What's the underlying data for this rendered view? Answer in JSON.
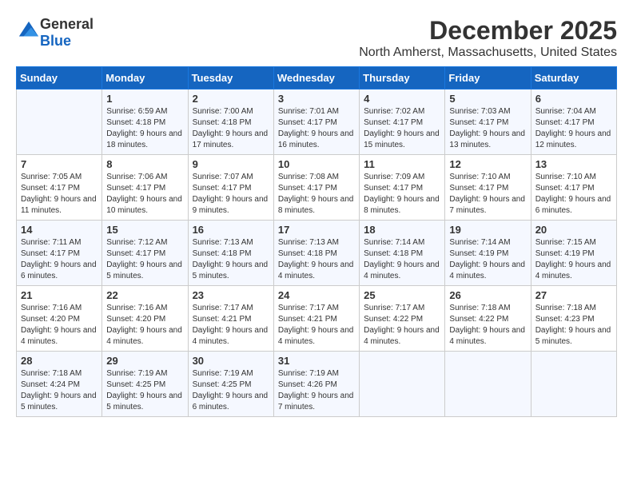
{
  "header": {
    "logo": {
      "general": "General",
      "blue": "Blue"
    },
    "title": "December 2025",
    "location": "North Amherst, Massachusetts, United States"
  },
  "weekdays": [
    "Sunday",
    "Monday",
    "Tuesday",
    "Wednesday",
    "Thursday",
    "Friday",
    "Saturday"
  ],
  "weeks": [
    [
      {
        "day": "",
        "sunrise": "",
        "sunset": "",
        "daylight": ""
      },
      {
        "day": "1",
        "sunrise": "Sunrise: 6:59 AM",
        "sunset": "Sunset: 4:18 PM",
        "daylight": "Daylight: 9 hours and 18 minutes."
      },
      {
        "day": "2",
        "sunrise": "Sunrise: 7:00 AM",
        "sunset": "Sunset: 4:18 PM",
        "daylight": "Daylight: 9 hours and 17 minutes."
      },
      {
        "day": "3",
        "sunrise": "Sunrise: 7:01 AM",
        "sunset": "Sunset: 4:17 PM",
        "daylight": "Daylight: 9 hours and 16 minutes."
      },
      {
        "day": "4",
        "sunrise": "Sunrise: 7:02 AM",
        "sunset": "Sunset: 4:17 PM",
        "daylight": "Daylight: 9 hours and 15 minutes."
      },
      {
        "day": "5",
        "sunrise": "Sunrise: 7:03 AM",
        "sunset": "Sunset: 4:17 PM",
        "daylight": "Daylight: 9 hours and 13 minutes."
      },
      {
        "day": "6",
        "sunrise": "Sunrise: 7:04 AM",
        "sunset": "Sunset: 4:17 PM",
        "daylight": "Daylight: 9 hours and 12 minutes."
      }
    ],
    [
      {
        "day": "7",
        "sunrise": "Sunrise: 7:05 AM",
        "sunset": "Sunset: 4:17 PM",
        "daylight": "Daylight: 9 hours and 11 minutes."
      },
      {
        "day": "8",
        "sunrise": "Sunrise: 7:06 AM",
        "sunset": "Sunset: 4:17 PM",
        "daylight": "Daylight: 9 hours and 10 minutes."
      },
      {
        "day": "9",
        "sunrise": "Sunrise: 7:07 AM",
        "sunset": "Sunset: 4:17 PM",
        "daylight": "Daylight: 9 hours and 9 minutes."
      },
      {
        "day": "10",
        "sunrise": "Sunrise: 7:08 AM",
        "sunset": "Sunset: 4:17 PM",
        "daylight": "Daylight: 9 hours and 8 minutes."
      },
      {
        "day": "11",
        "sunrise": "Sunrise: 7:09 AM",
        "sunset": "Sunset: 4:17 PM",
        "daylight": "Daylight: 9 hours and 8 minutes."
      },
      {
        "day": "12",
        "sunrise": "Sunrise: 7:10 AM",
        "sunset": "Sunset: 4:17 PM",
        "daylight": "Daylight: 9 hours and 7 minutes."
      },
      {
        "day": "13",
        "sunrise": "Sunrise: 7:10 AM",
        "sunset": "Sunset: 4:17 PM",
        "daylight": "Daylight: 9 hours and 6 minutes."
      }
    ],
    [
      {
        "day": "14",
        "sunrise": "Sunrise: 7:11 AM",
        "sunset": "Sunset: 4:17 PM",
        "daylight": "Daylight: 9 hours and 6 minutes."
      },
      {
        "day": "15",
        "sunrise": "Sunrise: 7:12 AM",
        "sunset": "Sunset: 4:17 PM",
        "daylight": "Daylight: 9 hours and 5 minutes."
      },
      {
        "day": "16",
        "sunrise": "Sunrise: 7:13 AM",
        "sunset": "Sunset: 4:18 PM",
        "daylight": "Daylight: 9 hours and 5 minutes."
      },
      {
        "day": "17",
        "sunrise": "Sunrise: 7:13 AM",
        "sunset": "Sunset: 4:18 PM",
        "daylight": "Daylight: 9 hours and 4 minutes."
      },
      {
        "day": "18",
        "sunrise": "Sunrise: 7:14 AM",
        "sunset": "Sunset: 4:18 PM",
        "daylight": "Daylight: 9 hours and 4 minutes."
      },
      {
        "day": "19",
        "sunrise": "Sunrise: 7:14 AM",
        "sunset": "Sunset: 4:19 PM",
        "daylight": "Daylight: 9 hours and 4 minutes."
      },
      {
        "day": "20",
        "sunrise": "Sunrise: 7:15 AM",
        "sunset": "Sunset: 4:19 PM",
        "daylight": "Daylight: 9 hours and 4 minutes."
      }
    ],
    [
      {
        "day": "21",
        "sunrise": "Sunrise: 7:16 AM",
        "sunset": "Sunset: 4:20 PM",
        "daylight": "Daylight: 9 hours and 4 minutes."
      },
      {
        "day": "22",
        "sunrise": "Sunrise: 7:16 AM",
        "sunset": "Sunset: 4:20 PM",
        "daylight": "Daylight: 9 hours and 4 minutes."
      },
      {
        "day": "23",
        "sunrise": "Sunrise: 7:17 AM",
        "sunset": "Sunset: 4:21 PM",
        "daylight": "Daylight: 9 hours and 4 minutes."
      },
      {
        "day": "24",
        "sunrise": "Sunrise: 7:17 AM",
        "sunset": "Sunset: 4:21 PM",
        "daylight": "Daylight: 9 hours and 4 minutes."
      },
      {
        "day": "25",
        "sunrise": "Sunrise: 7:17 AM",
        "sunset": "Sunset: 4:22 PM",
        "daylight": "Daylight: 9 hours and 4 minutes."
      },
      {
        "day": "26",
        "sunrise": "Sunrise: 7:18 AM",
        "sunset": "Sunset: 4:22 PM",
        "daylight": "Daylight: 9 hours and 4 minutes."
      },
      {
        "day": "27",
        "sunrise": "Sunrise: 7:18 AM",
        "sunset": "Sunset: 4:23 PM",
        "daylight": "Daylight: 9 hours and 5 minutes."
      }
    ],
    [
      {
        "day": "28",
        "sunrise": "Sunrise: 7:18 AM",
        "sunset": "Sunset: 4:24 PM",
        "daylight": "Daylight: 9 hours and 5 minutes."
      },
      {
        "day": "29",
        "sunrise": "Sunrise: 7:19 AM",
        "sunset": "Sunset: 4:25 PM",
        "daylight": "Daylight: 9 hours and 5 minutes."
      },
      {
        "day": "30",
        "sunrise": "Sunrise: 7:19 AM",
        "sunset": "Sunset: 4:25 PM",
        "daylight": "Daylight: 9 hours and 6 minutes."
      },
      {
        "day": "31",
        "sunrise": "Sunrise: 7:19 AM",
        "sunset": "Sunset: 4:26 PM",
        "daylight": "Daylight: 9 hours and 7 minutes."
      },
      {
        "day": "",
        "sunrise": "",
        "sunset": "",
        "daylight": ""
      },
      {
        "day": "",
        "sunrise": "",
        "sunset": "",
        "daylight": ""
      },
      {
        "day": "",
        "sunrise": "",
        "sunset": "",
        "daylight": ""
      }
    ]
  ]
}
